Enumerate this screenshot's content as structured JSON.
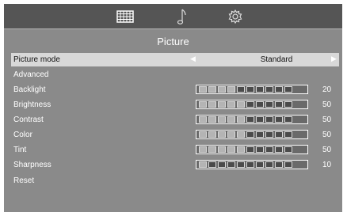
{
  "topbar": {
    "tabs": [
      {
        "icon": "picture-grid-icon"
      },
      {
        "icon": "music-note-icon"
      },
      {
        "icon": "gear-icon"
      }
    ]
  },
  "title": "Picture",
  "rows": {
    "picture_mode": {
      "label": "Picture mode",
      "value": "Standard"
    },
    "advanced": {
      "label": "Advanced"
    },
    "backlight": {
      "label": "Backlight",
      "value": "20"
    },
    "brightness": {
      "label": "Brightness",
      "value": "50"
    },
    "contrast": {
      "label": "Contrast",
      "value": "50"
    },
    "color": {
      "label": "Color",
      "value": "50"
    },
    "tint": {
      "label": "Tint",
      "value": "50"
    },
    "sharpness": {
      "label": "Sharpness",
      "value": "10"
    },
    "reset": {
      "label": "Reset"
    }
  },
  "colors": {
    "background": "#8a8a8a",
    "topbar": "#555555",
    "highlight": "#d8d8d8"
  }
}
